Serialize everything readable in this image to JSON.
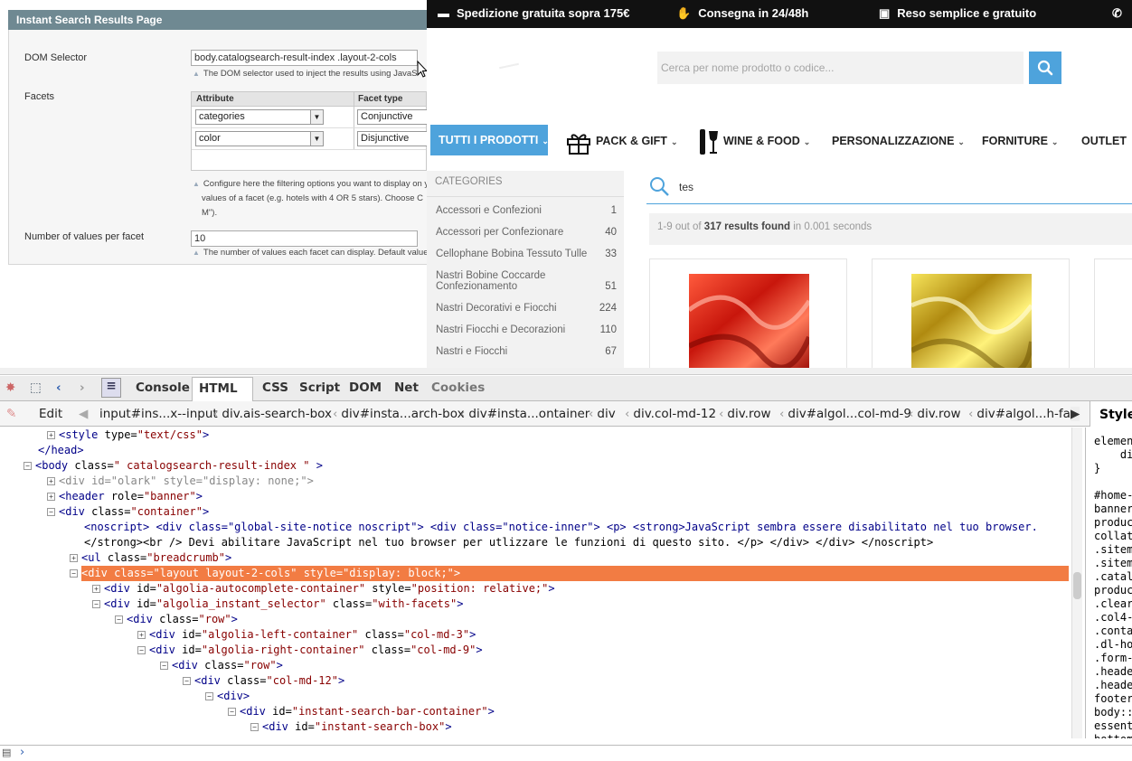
{
  "admin": {
    "section_title": "Instant Search Results Page",
    "dom_selector_label": "DOM Selector",
    "dom_selector_value": "body.catalogsearch-result-index .layout-2-cols",
    "dom_selector_note": "The DOM selector used to inject the results using JavaS",
    "facets_label": "Facets",
    "facet_col_attribute": "Attribute",
    "facet_col_type": "Facet type",
    "facet_rows": [
      {
        "attribute": "categories",
        "type": "Conjunctive"
      },
      {
        "attribute": "color",
        "type": "Disjunctive"
      }
    ],
    "facets_note_1": "Configure here the filtering options you want to display on y",
    "facets_note_2": "values of a facet (e.g. hotels with 4 OR 5 stars). Choose C",
    "facets_note_3": "M\").",
    "values_label": "Number of values per facet",
    "values_value": "10",
    "values_note": "The number of values each facet can display. Default value"
  },
  "shop": {
    "topbar": [
      "Spedizione gratuita sopra 175€",
      "Consegna in 24/48h",
      "Reso semplice e gratuito"
    ],
    "search_placeholder": "Cerca per nome prodotto o codice...",
    "nav": {
      "all": "TUTTI I PRODOTTI",
      "items": [
        "PACK & GIFT",
        "WINE & FOOD",
        "PERSONALIZZAZIONE",
        "FORNITURE",
        "OUTLET"
      ]
    },
    "categories_heading": "CATEGORIES",
    "categories": [
      {
        "name": "Accessori e Confezioni",
        "count": "1"
      },
      {
        "name": "Accessori per Confezionare",
        "count": "40"
      },
      {
        "name": "Cellophane Bobina Tessuto Tulle",
        "count": "33"
      },
      {
        "name": "Nastri Bobine Coccarde Confezionamento",
        "count": "51"
      },
      {
        "name": "Nastri Decorativi e Fiocchi",
        "count": "224"
      },
      {
        "name": "Nastri Fiocchi e Decorazioni",
        "count": "110"
      },
      {
        "name": "Nastri e Fiocchi",
        "count": "67"
      }
    ],
    "query": "tes",
    "stats_prefix": "1-9 out of",
    "stats_count": "317 results found",
    "stats_suffix": "in 0.001 seconds"
  },
  "firebug": {
    "tabs": [
      "Console",
      "HTML",
      "CSS",
      "Script",
      "DOM",
      "Net",
      "Cookies"
    ],
    "edit": "Edit",
    "breadcrumbs": [
      "input#ins...x--input",
      "div.ais-search-box",
      "div#insta...arch-box",
      "div#insta...ontainer",
      "div",
      "div.col-md-12",
      "div.row",
      "div#algol...col-md-9",
      "div.row",
      "div#algol...h-fac"
    ],
    "side_tab": "Style",
    "side_lines": [
      "elemen",
      "    di",
      "}",
      "",
      "#home-",
      "banner",
      "produc",
      "collat",
      ".sitem",
      ".sitem",
      ".catal",
      "produc",
      ".clear",
      ".col4-",
      ".conta",
      ".dl-ho",
      ".form-",
      ".heade",
      ".heade",
      "footer",
      "body::",
      "essent",
      "bottom"
    ],
    "tree_text": {
      "style_type": "text/css",
      "head_close": "</head>",
      "body_class": " catalogsearch-result-index ",
      "olark": "olark",
      "olark_style": "display: none;",
      "header_role": "banner",
      "container": "container",
      "noscript_1": "<noscript> <div class=\"global-site-notice noscript\"> <div class=\"notice-inner\"> <p> <strong>JavaScript sembra essere disabilitato nel tuo browser.",
      "noscript_2": "</strong><br /> Devi abilitare JavaScript nel tuo browser per utlizzare le funzioni di questo sito. </p> </div> </div> </noscript>",
      "breadcrumb": "breadcrumb",
      "layout_class": "layout layout-2-cols",
      "layout_style": "display: block;",
      "auto_id": "algolia-autocomplete-container",
      "auto_style": "position: relative;",
      "instant_id": "algolia_instant_selector",
      "instant_class": "with-facets",
      "row": "row",
      "left_id": "algolia-left-container",
      "col3": "col-md-3",
      "right_id": "algolia-right-container",
      "col9": "col-md-9",
      "col12": "col-md-12",
      "bar_id": "instant-search-bar-container",
      "box_id": "instant-search-box"
    }
  }
}
